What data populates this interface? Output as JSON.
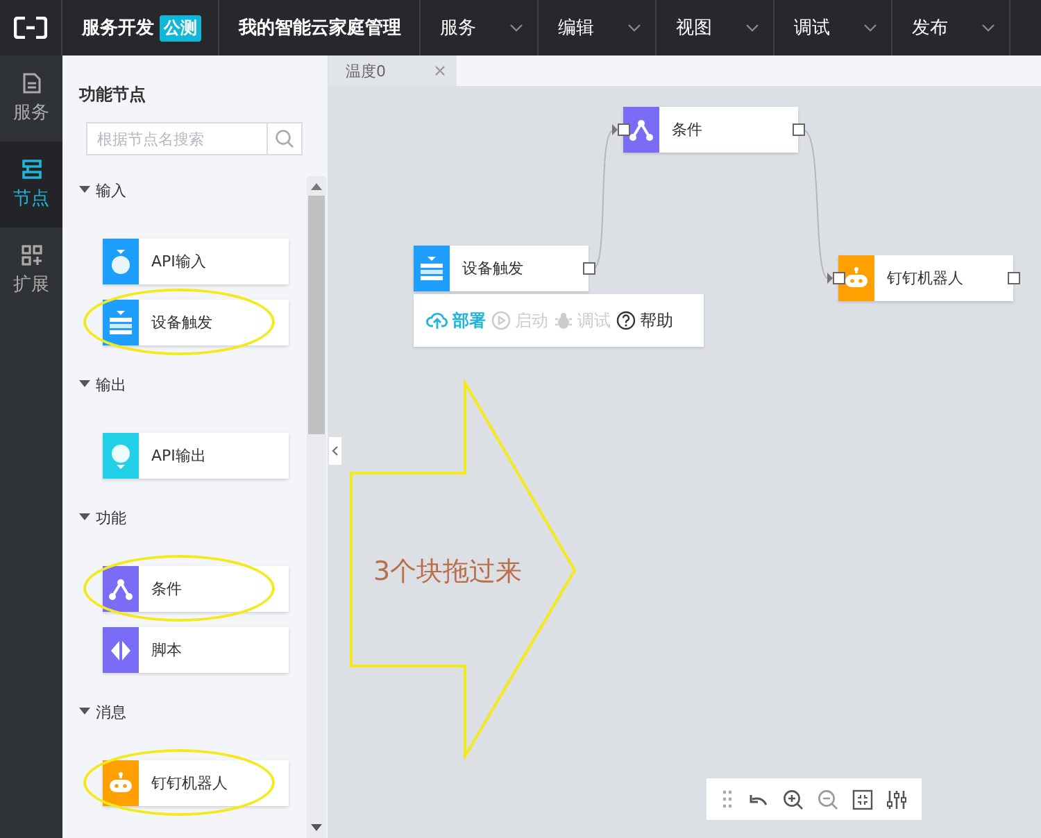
{
  "header": {
    "product": "服务开发",
    "badge": "公测",
    "project": "我的智能云家庭管理",
    "menus": [
      "服务",
      "编辑",
      "视图",
      "调试",
      "发布"
    ]
  },
  "rail": [
    {
      "label": "服务",
      "kind": "doc",
      "selected": false
    },
    {
      "label": "节点",
      "kind": "nodes",
      "selected": true
    },
    {
      "label": "扩展",
      "kind": "grid",
      "selected": false
    }
  ],
  "palette": {
    "title": "功能节点",
    "search": {
      "placeholder": "根据节点名搜索"
    },
    "groups": [
      {
        "label": "输入",
        "expanded": true,
        "items": [
          {
            "label": "API输入",
            "kind": "api-in",
            "highlighted": false
          },
          {
            "label": "设备触发",
            "kind": "device",
            "highlighted": true
          }
        ]
      },
      {
        "label": "输出",
        "expanded": true,
        "items": [
          {
            "label": "API输出",
            "kind": "api-out",
            "highlighted": false
          }
        ]
      },
      {
        "label": "功能",
        "expanded": true,
        "items": [
          {
            "label": "条件",
            "kind": "condition",
            "highlighted": true
          },
          {
            "label": "脚本",
            "kind": "script",
            "highlighted": false
          }
        ]
      },
      {
        "label": "消息",
        "expanded": true,
        "items": [
          {
            "label": "钉钉机器人",
            "kind": "robot",
            "highlighted": true
          }
        ]
      }
    ]
  },
  "canvas": {
    "tabs": [
      {
        "label": "温度0",
        "selected": true
      }
    ],
    "nodes": [
      {
        "label": "条件",
        "kind": "condition",
        "input_port": true,
        "output_port": true
      },
      {
        "label": "设备触发",
        "kind": "device",
        "input_port": false,
        "output_port": true
      },
      {
        "label": "钉钉机器人",
        "kind": "robot",
        "input_port": true,
        "output_port": true
      }
    ],
    "node_toolbar": [
      {
        "label": "部署",
        "kind": "deploy",
        "disabled": false,
        "primary": true
      },
      {
        "label": "启动",
        "kind": "start",
        "disabled": true,
        "primary": false
      },
      {
        "label": "调试",
        "kind": "debug",
        "disabled": true,
        "primary": false
      },
      {
        "label": "帮助",
        "kind": "help",
        "disabled": false,
        "primary": false
      }
    ],
    "annotation": {
      "text": "3个块拖过来"
    }
  }
}
